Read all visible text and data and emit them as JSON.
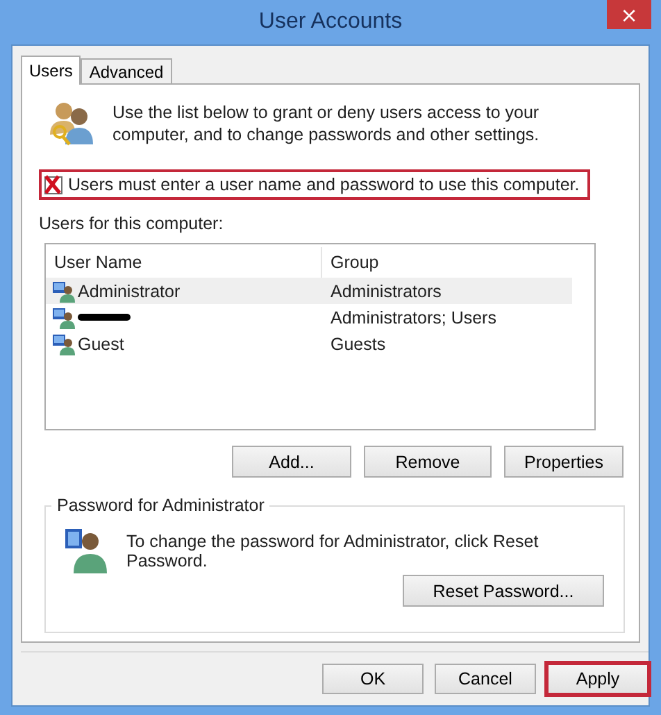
{
  "window": {
    "title": "User Accounts",
    "close": "×"
  },
  "tabs": [
    {
      "label": "Users",
      "selected": true
    },
    {
      "label": "Advanced",
      "selected": false
    }
  ],
  "intro": "Use the list below to grant or deny users access to your computer, and to change passwords and other settings.",
  "require_login": {
    "label": "Users must enter a user name and password to use this computer.",
    "checked": false,
    "highlighted": true
  },
  "users_label": "Users for this computer:",
  "table": {
    "columns": [
      "User Name",
      "Group"
    ],
    "rows": [
      {
        "name": "Administrator",
        "group": "Administrators",
        "selected": true,
        "redacted": false
      },
      {
        "group": "Administrators; Users",
        "selected": false,
        "redacted": true
      },
      {
        "name": "Guest",
        "group": "Guests",
        "selected": false,
        "redacted": false
      }
    ]
  },
  "list_buttons": [
    "Add...",
    "Remove",
    "Properties"
  ],
  "password_group": {
    "title": "Password for Administrator",
    "text": "To change the password for Administrator, click Reset Password.",
    "button": "Reset Password..."
  },
  "footer_buttons": [
    {
      "label": "OK",
      "highlighted": false
    },
    {
      "label": "Cancel",
      "highlighted": false
    },
    {
      "label": "Apply",
      "highlighted": true
    }
  ]
}
